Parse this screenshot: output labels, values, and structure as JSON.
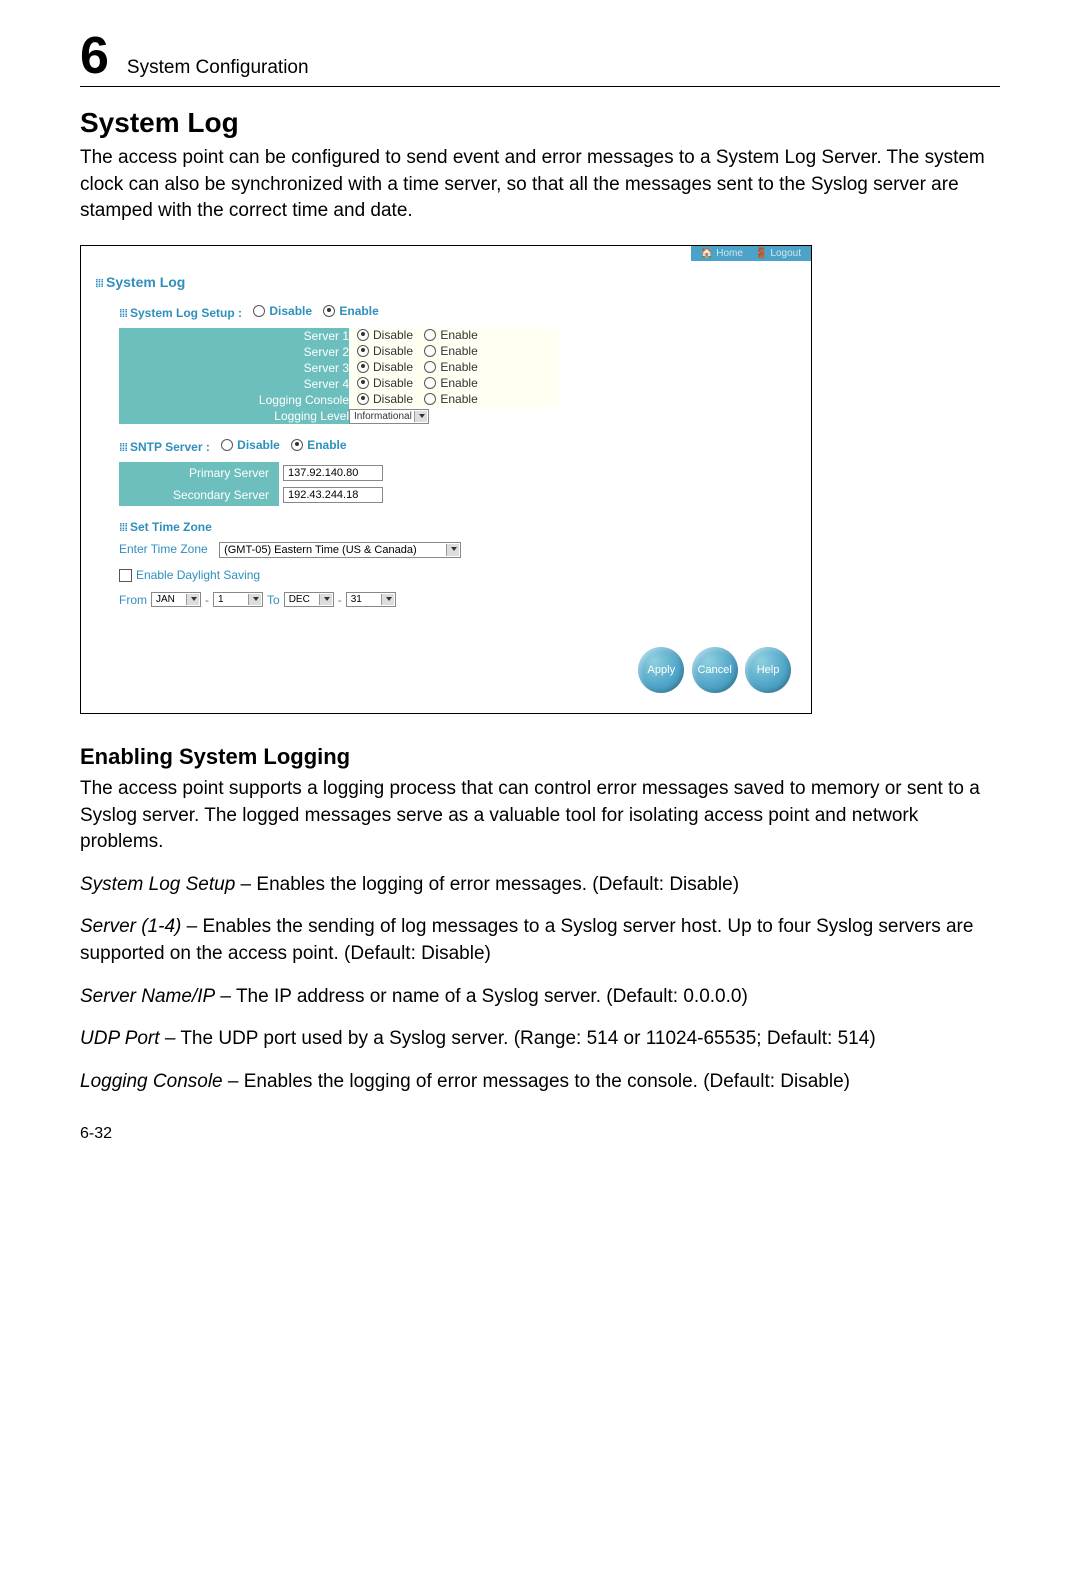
{
  "chapter": {
    "number": "6",
    "label": "System Configuration"
  },
  "section_title": "System Log",
  "intro": "The access point can be configured to send event and error messages to a System Log Server. The system clock can also be synchronized with a time server, so that all the messages sent to the Syslog server are stamped with the correct time and date.",
  "scr": {
    "top": {
      "home": "Home",
      "logout": "Logout"
    },
    "heading": "System Log",
    "setup": {
      "label": "System Log Setup  :",
      "disable": "Disable",
      "enable": "Enable",
      "selected": "enable"
    },
    "servers": [
      {
        "label": "Server 1",
        "disable": "Disable",
        "enable": "Enable",
        "selected": "disable"
      },
      {
        "label": "Server 2",
        "disable": "Disable",
        "enable": "Enable",
        "selected": "disable"
      },
      {
        "label": "Server 3",
        "disable": "Disable",
        "enable": "Enable",
        "selected": "disable"
      },
      {
        "label": "Server 4",
        "disable": "Disable",
        "enable": "Enable",
        "selected": "disable"
      }
    ],
    "logging_console": {
      "label": "Logging Console",
      "disable": "Disable",
      "enable": "Enable",
      "selected": "disable"
    },
    "logging_level": {
      "label": "Logging Level",
      "value": "Informational"
    },
    "sntp": {
      "label": "SNTP Server  :",
      "disable": "Disable",
      "enable": "Enable",
      "selected": "enable",
      "primary": {
        "label": "Primary Server",
        "value": "137.92.140.80"
      },
      "secondary": {
        "label": "Secondary Server",
        "value": "192.43.244.18"
      }
    },
    "tz": {
      "heading": "Set Time Zone",
      "enter_label": "Enter Time Zone",
      "value": "(GMT-05) Eastern Time (US & Canada)"
    },
    "ds": {
      "label": "Enable Daylight Saving",
      "from": "From",
      "to": "To",
      "from_month": "JAN",
      "from_day": "1",
      "to_month": "DEC",
      "to_day": "31"
    },
    "buttons": {
      "apply": "Apply",
      "cancel": "Cancel",
      "help": "Help"
    }
  },
  "sub_title": "Enabling System Logging",
  "sub_intro": "The access point supports a logging process that can control error messages saved to memory or sent to a Syslog server. The logged messages serve as a valuable tool for isolating access point and network problems.",
  "defs": {
    "d1_em": "System Log Setup",
    "d1_txt": " – Enables the logging of error messages. (Default: Disable)",
    "d2_em": "Server (1-4)",
    "d2_txt": " – Enables the sending of log messages to a Syslog server host. Up to four Syslog servers are supported on the access point. (Default: Disable)",
    "d3_em": "Server Name/IP",
    "d3_txt": " – The IP address or name of a Syslog server. (Default: 0.0.0.0)",
    "d4_em": "UDP Port",
    "d4_txt": " – The UDP port used by a Syslog server. (Range: 514 or 11024-65535; Default: 514)",
    "d5_em": "Logging Console",
    "d5_txt": " – Enables the logging of error messages to the console. (Default: Disable)"
  },
  "page_num": "6-32"
}
